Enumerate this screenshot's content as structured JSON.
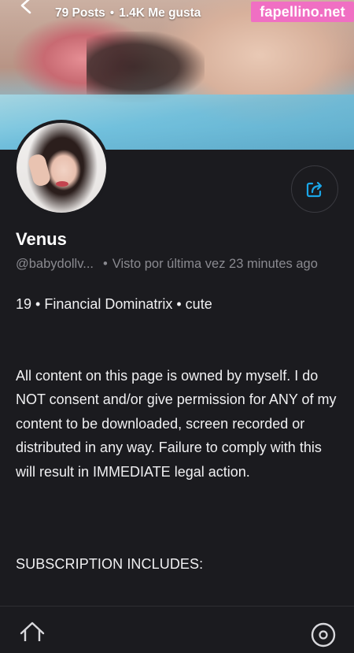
{
  "header": {
    "posts": "79 Posts",
    "likes": "1.4K Me gusta",
    "watermark": "fapellino.net"
  },
  "profile": {
    "name": "Venus",
    "handle": "@babydollv...",
    "last_seen": "Visto por última vez 23 minutes ago",
    "tagline": "19 • Financial Dominatrix • cute",
    "bio": "All content on this page is owned by myself. I do NOT consent and/or give permission for ANY of my content to be downloaded, screen recorded or distributed in any way. Failure to comply with this will result in IMMEDIATE legal action.",
    "subscription_heading": "SUBSCRIPTION INCLUDES:"
  },
  "icons": {
    "back": "back-arrow-icon",
    "share": "share-icon",
    "home": "home-icon",
    "nav_right": "compass-icon"
  },
  "colors": {
    "background": "#1b1b1f",
    "accent": "#1aa6e8",
    "watermark": "#f06fc3"
  }
}
